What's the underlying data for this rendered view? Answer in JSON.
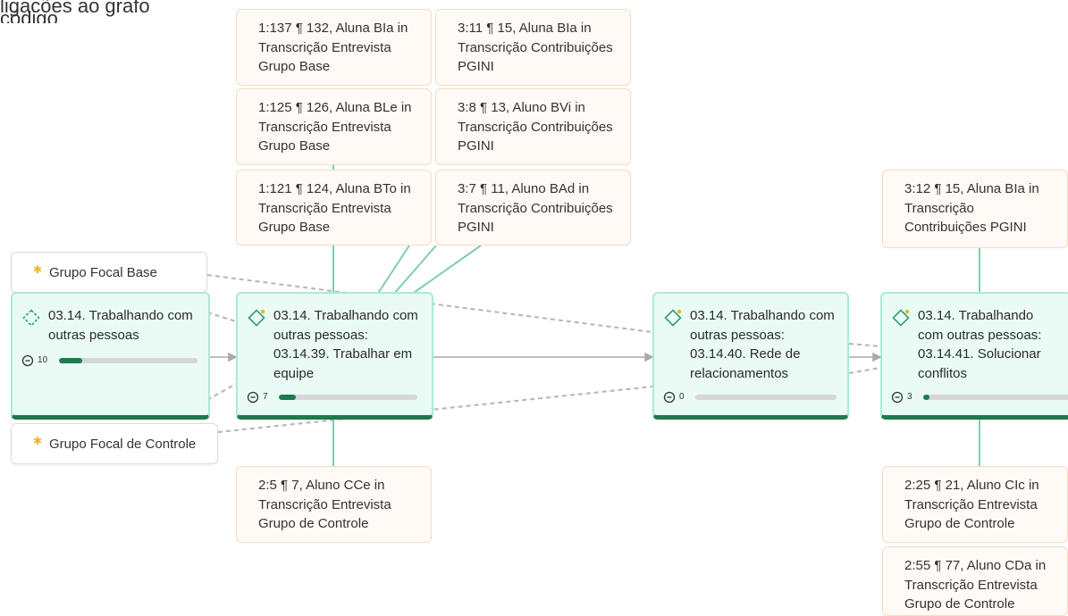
{
  "top_cut_text": "ligacões ao grafo código",
  "documents": [
    {
      "id": "doc-base",
      "label": "Grupo Focal Base"
    },
    {
      "id": "doc-controle",
      "label": "Grupo Focal de Controle"
    }
  ],
  "codes": [
    {
      "id": "parent",
      "title": "03.14. Trabalhando com outras pessoas",
      "count": "10",
      "progress": 0.17,
      "icon": "dashed-diamond-icon"
    },
    {
      "id": "c39",
      "title": "03.14. Trabalhando com outras pessoas: 03.14.39. Trabalhar em equipe",
      "count": "7",
      "progress": 0.12,
      "icon": "diamond-star-icon"
    },
    {
      "id": "c40",
      "title": "03.14. Trabalhando com outras pessoas: 03.14.40. Rede de relacionamentos",
      "count": "0",
      "progress": 0.0,
      "icon": "diamond-star-icon"
    },
    {
      "id": "c41",
      "title": "03.14. Trabalhando com outras pessoas: 03.14.41. Solucionar conflitos",
      "count": "3",
      "progress": 0.04,
      "icon": "diamond-star-icon"
    }
  ],
  "quotations": [
    {
      "id": "q1",
      "text": "1:137 ¶ 132, Aluna BIa in Transcrição Entrevista Grupo Base"
    },
    {
      "id": "q2",
      "text": "3:11 ¶ 15, Aluna BIa in Transcrição Contribuições PGINI"
    },
    {
      "id": "q3",
      "text": "1:125 ¶ 126, Aluna BLe in Transcrição Entrevista Grupo Base"
    },
    {
      "id": "q4",
      "text": "3:8 ¶ 13, Aluno BVi in Transcrição Contribuições PGINI"
    },
    {
      "id": "q5",
      "text": "1:121 ¶ 124, Aluna BTo in Transcrição Entrevista Grupo Base"
    },
    {
      "id": "q6",
      "text": "3:7 ¶ 11, Aluno BAd in Transcrição Contribuições PGINI"
    },
    {
      "id": "q7",
      "text": "2:5 ¶ 7, Aluno CCe in Transcrição Entrevista Grupo de Controle"
    },
    {
      "id": "q8",
      "text": "3:12 ¶ 15, Aluna BIa in Transcrição Contribuições PGINI"
    },
    {
      "id": "q9",
      "text": "2:25 ¶ 21, Aluno CIc in Transcrição Entrevista Grupo de Controle"
    },
    {
      "id": "q10",
      "text": "2:55 ¶ 77, Aluno CDa in Transcrição Entrevista Grupo de Controle"
    }
  ],
  "colors": {
    "accent": "#1d7a4e",
    "node_fill": "#e9fbf4",
    "node_border": "#a8ecd4",
    "quote_fill": "#fffaf5",
    "quote_border": "#f3dcc4",
    "edge": "#a8a8b4",
    "link_green": "#7fcfa8",
    "star": "#f0b429"
  }
}
